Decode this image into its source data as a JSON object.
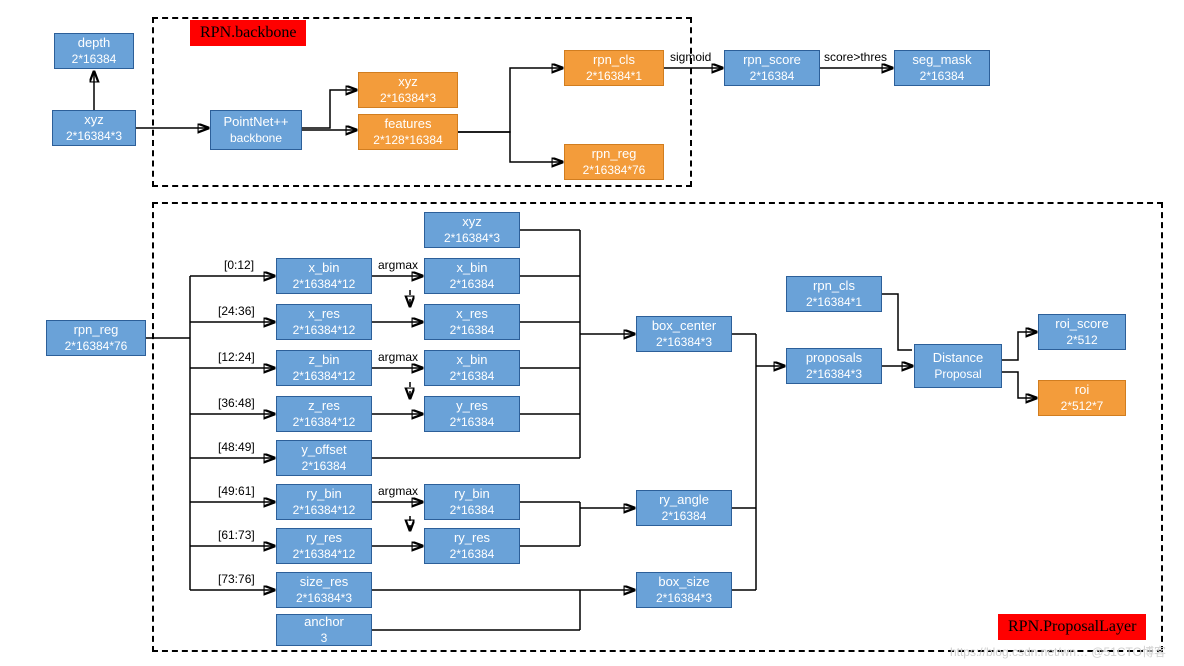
{
  "labels": {
    "backbone": "RPN.backbone",
    "proposal": "RPN.ProposalLayer"
  },
  "edge": {
    "sigmoid": "sigmoid",
    "scorethres": "score>thres",
    "argmax1": "argmax",
    "argmax2": "argmax",
    "argmax3": "argmax"
  },
  "slices": {
    "s0": "[0:12]",
    "s1": "[24:36]",
    "s2": "[12:24]",
    "s3": "[36:48]",
    "s4": "[48:49]",
    "s5": "[49:61]",
    "s6": "[61:73]",
    "s7": "[73:76]"
  },
  "nodes": {
    "depth": {
      "t": "depth",
      "s": "2*16384"
    },
    "xyz0": {
      "t": "xyz",
      "s": "2*16384*3"
    },
    "pn": {
      "t": "PointNet++",
      "s": "backbone"
    },
    "xyz1": {
      "t": "xyz",
      "s": "2*16384*3"
    },
    "features": {
      "t": "features",
      "s": "2*128*16384"
    },
    "rpn_cls": {
      "t": "rpn_cls",
      "s": "2*16384*1"
    },
    "rpn_reg": {
      "t": "rpn_reg",
      "s": "2*16384*76"
    },
    "rpn_score": {
      "t": "rpn_score",
      "s": "2*16384"
    },
    "seg_mask": {
      "t": "seg_mask",
      "s": "2*16384"
    },
    "rpn_reg2": {
      "t": "rpn_reg",
      "s": "2*16384*76"
    },
    "xyz2": {
      "t": "xyz",
      "s": "2*16384*3"
    },
    "x_bin": {
      "t": "x_bin",
      "s": "2*16384*12"
    },
    "x_bin2": {
      "t": "x_bin",
      "s": "2*16384"
    },
    "x_res": {
      "t": "x_res",
      "s": "2*16384*12"
    },
    "x_res2": {
      "t": "x_res",
      "s": "2*16384"
    },
    "z_bin": {
      "t": "z_bin",
      "s": "2*16384*12"
    },
    "x_bin3": {
      "t": "x_bin",
      "s": "2*16384"
    },
    "z_res": {
      "t": "z_res",
      "s": "2*16384*12"
    },
    "y_res": {
      "t": "y_res",
      "s": "2*16384"
    },
    "y_offset": {
      "t": "y_offset",
      "s": "2*16384"
    },
    "ry_bin": {
      "t": "ry_bin",
      "s": "2*16384*12"
    },
    "ry_bin2": {
      "t": "ry_bin",
      "s": "2*16384"
    },
    "ry_res": {
      "t": "ry_res",
      "s": "2*16384*12"
    },
    "ry_res2": {
      "t": "ry_res",
      "s": "2*16384"
    },
    "size_res": {
      "t": "size_res",
      "s": "2*16384*3"
    },
    "anchor": {
      "t": "anchor",
      "s": "3"
    },
    "box_center": {
      "t": "box_center",
      "s": "2*16384*3"
    },
    "ry_angle": {
      "t": "ry_angle",
      "s": "2*16384"
    },
    "box_size": {
      "t": "box_size",
      "s": "2*16384*3"
    },
    "rpn_cls2": {
      "t": "rpn_cls",
      "s": "2*16384*1"
    },
    "proposals": {
      "t": "proposals",
      "s": "2*16384*3"
    },
    "distprop": {
      "t": "Distance",
      "s": "Proposal"
    },
    "roi_score": {
      "t": "roi_score",
      "s": "2*512"
    },
    "roi": {
      "t": "roi",
      "s": "2*512*7"
    }
  },
  "watermark": "https://blog.csdn.net/wn… @51CTO博客"
}
